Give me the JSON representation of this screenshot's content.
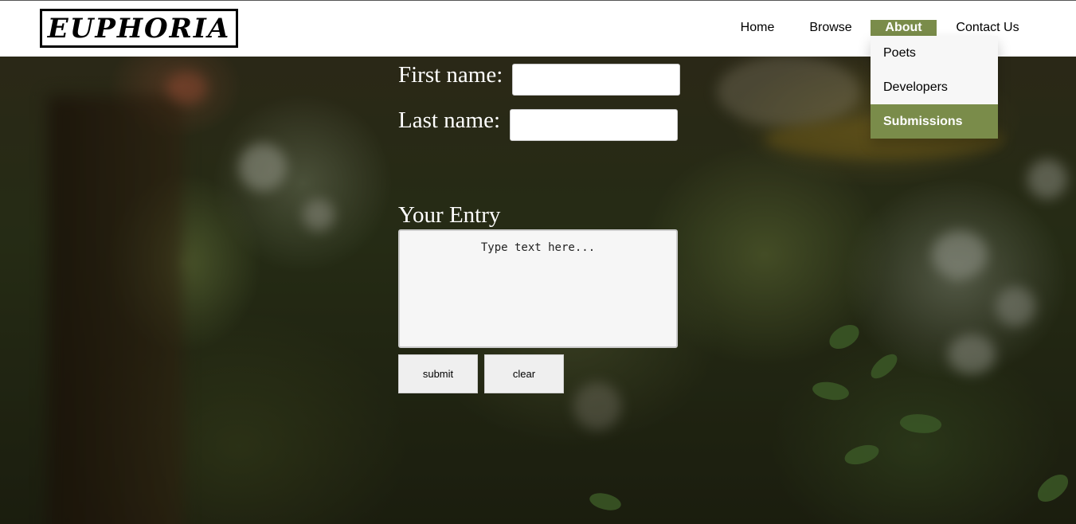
{
  "header": {
    "logo_text": "EUPHORIA",
    "nav": {
      "home": "Home",
      "browse": "Browse",
      "about": "About",
      "contact": "Contact Us"
    },
    "about_dropdown": [
      "Poets",
      "Developers",
      "Submissions"
    ],
    "active_nav": "About",
    "active_dropdown_item": "Submissions"
  },
  "form": {
    "first_name_label": "First name:",
    "first_name_value": "",
    "last_name_label": "Last name:",
    "last_name_value": "",
    "entry_label": "Your Entry",
    "entry_placeholder": "Type text here...",
    "submit_label": "submit",
    "clear_label": "clear"
  },
  "colors": {
    "accent": "#7a8c4a",
    "header_bg": "#ffffff",
    "dropdown_bg": "#f7f7f7"
  }
}
